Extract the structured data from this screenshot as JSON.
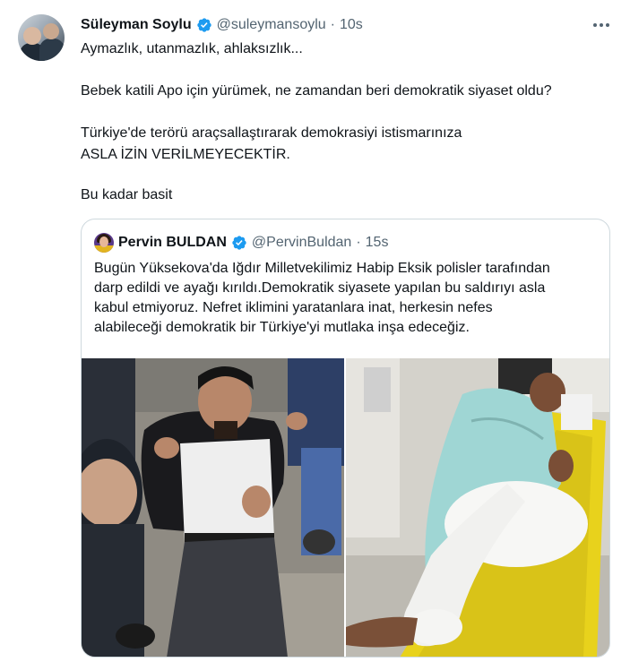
{
  "tweet": {
    "author_name": "Süleyman Soylu",
    "author_handle": "@suleymansoylu",
    "separator": "·",
    "time": "10s",
    "lines": [
      "Aymazlık, utanmazlık, ahlaksızlık...",
      "Bebek katili Apo için yürümek, ne zamandan beri demokratik siyaset oldu?",
      "Türkiye'de terörü araçsallaştırarak demokrasiyi istismarınıza",
      "ASLA İZİN VERİLMEYECEKTİR.",
      "Bu kadar basit"
    ]
  },
  "quoted": {
    "author_name": "Pervin BULDAN",
    "author_handle": "@PervinBuldan",
    "separator": "·",
    "time": "15s",
    "lines": [
      "Bugün Yüksekova'da Iğdır Milletvekilimiz Habip Eksik polisler tarafından",
      "darp edildi ve ayağı kırıldı.Demokratik siyasete yapılan bu saldırıyı asla",
      "kabul etmiyoruz. Nefret iklimini yaratanlara inat, herkesin nefes",
      "alabileceği demokratik bir Türkiye'yi mutlaka inşa edeceğiz."
    ]
  },
  "icons": {
    "verified": "verified-badge-icon",
    "more": "more-options-icon"
  },
  "colors": {
    "verified": "#1d9bf0",
    "text": "#0f1419",
    "secondary": "#536471",
    "border": "#cfd9de"
  }
}
